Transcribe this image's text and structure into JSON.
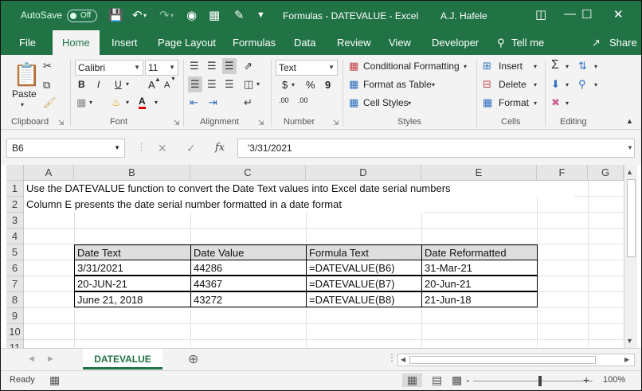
{
  "titlebar": {
    "autosave_label": "AutoSave",
    "autosave_state": "Off",
    "doc_title": "Formulas - DATEVALUE  -  Excel",
    "user": "A.J. Hafele"
  },
  "tabs": [
    "File",
    "Home",
    "Insert",
    "Page Layout",
    "Formulas",
    "Data",
    "Review",
    "Developer",
    "Tell me",
    "Share"
  ],
  "ribbon": {
    "clipboard": {
      "label": "Clipboard",
      "paste": "Paste"
    },
    "font": {
      "label": "Font",
      "name": "Calibri",
      "size": "11",
      "bold": "B",
      "italic": "I",
      "underline": "U",
      "grow": "A",
      "shrink": "A"
    },
    "alignment": {
      "label": "Alignment"
    },
    "number": {
      "label": "Number",
      "format": "Text",
      "currency": "$",
      "percent": "%",
      "comma": "9",
      "inc_dec": ".00",
      "dec_dec": ".00"
    },
    "styles": {
      "label": "Styles",
      "conditional": "Conditional Formatting",
      "table": "Format as Table",
      "cell_styles": "Cell Styles"
    },
    "cells": {
      "label": "Cells",
      "insert": "Insert",
      "delete": "Delete",
      "format": "Format"
    },
    "editing": {
      "label": "Editing"
    }
  },
  "formula_bar": {
    "name_box": "B6",
    "fx": "fx",
    "content": "'3/31/2021"
  },
  "grid": {
    "columns": [
      "A",
      "B",
      "C",
      "D",
      "E",
      "F",
      "G"
    ],
    "rows": [
      "1",
      "2",
      "3",
      "4",
      "5",
      "6",
      "7",
      "8",
      "9",
      "10",
      "11"
    ],
    "row1": "Use the DATEVALUE function to convert the Date Text values into Excel date serial numbers",
    "row2": "Column E presents the date serial number formatted in a date format",
    "table": {
      "headers": [
        "Date Text",
        "Date Value",
        "Formula Text",
        "Date Reformatted"
      ],
      "rows": [
        [
          "3/31/2021",
          "44286",
          "=DATEVALUE(B6)",
          "31-Mar-21"
        ],
        [
          "20-JUN-21",
          "44367",
          "=DATEVALUE(B7)",
          "20-Jun-21"
        ],
        [
          "June 21, 2018",
          "43272",
          "=DATEVALUE(B8)",
          "21-Jun-18"
        ]
      ]
    }
  },
  "sheet": {
    "tab": "DATEVALUE"
  },
  "status": {
    "ready": "Ready",
    "zoom": "100%",
    "minus": "-",
    "plus": "+"
  },
  "colors": {
    "brand": "#217346",
    "ribbon_bg": "#f3f3f3",
    "table_header_bg": "#dedede"
  }
}
